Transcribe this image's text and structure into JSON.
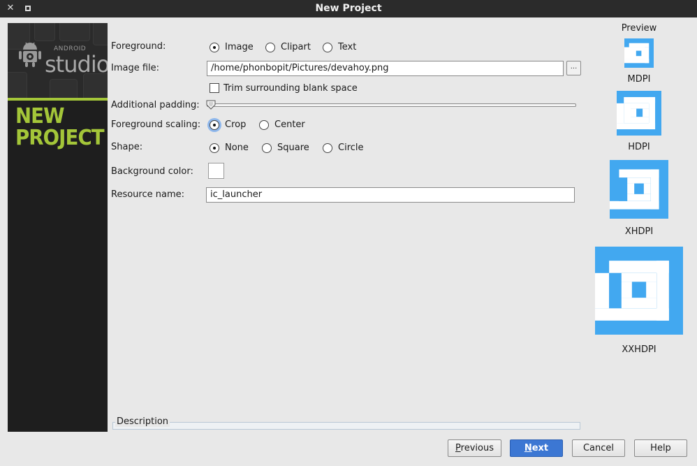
{
  "window": {
    "title": "New Project",
    "close_glyph": "✕",
    "maximize_glyph": "□"
  },
  "banner": {
    "logo_small": "ANDROID",
    "logo_big": "studio",
    "heading_line1": "NEW",
    "heading_line2": "PROJECT",
    "accent_color": "#a4c639"
  },
  "form": {
    "foreground_label": "Foreground:",
    "foreground_options": [
      "Image",
      "Clipart",
      "Text"
    ],
    "foreground_selected": "Image",
    "image_file_label": "Image file:",
    "image_file_value": "/home/phonbopit/Pictures/devahoy.png",
    "browse_label": "...",
    "trim_label": "Trim surrounding blank space",
    "trim_checked": false,
    "padding_label": "Additional padding:",
    "padding_value": 0,
    "scaling_label": "Foreground scaling:",
    "scaling_options": [
      "Crop",
      "Center"
    ],
    "scaling_selected": "Crop",
    "shape_label": "Shape:",
    "shape_options": [
      "None",
      "Square",
      "Circle"
    ],
    "shape_selected": "None",
    "bgcolor_label": "Background color:",
    "bgcolor_value": "#ffffff",
    "resource_label": "Resource name:",
    "resource_value": "ic_launcher",
    "description_label": "Description"
  },
  "preview": {
    "title": "Preview",
    "icon_color": "#42a8f0",
    "items": [
      "MDPI",
      "HDPI",
      "XHDPI",
      "XXHDPI"
    ]
  },
  "buttons": {
    "previous_first": "P",
    "previous_rest": "revious",
    "next_first": "N",
    "next_rest": "ext",
    "cancel": "Cancel",
    "help": "Help"
  }
}
